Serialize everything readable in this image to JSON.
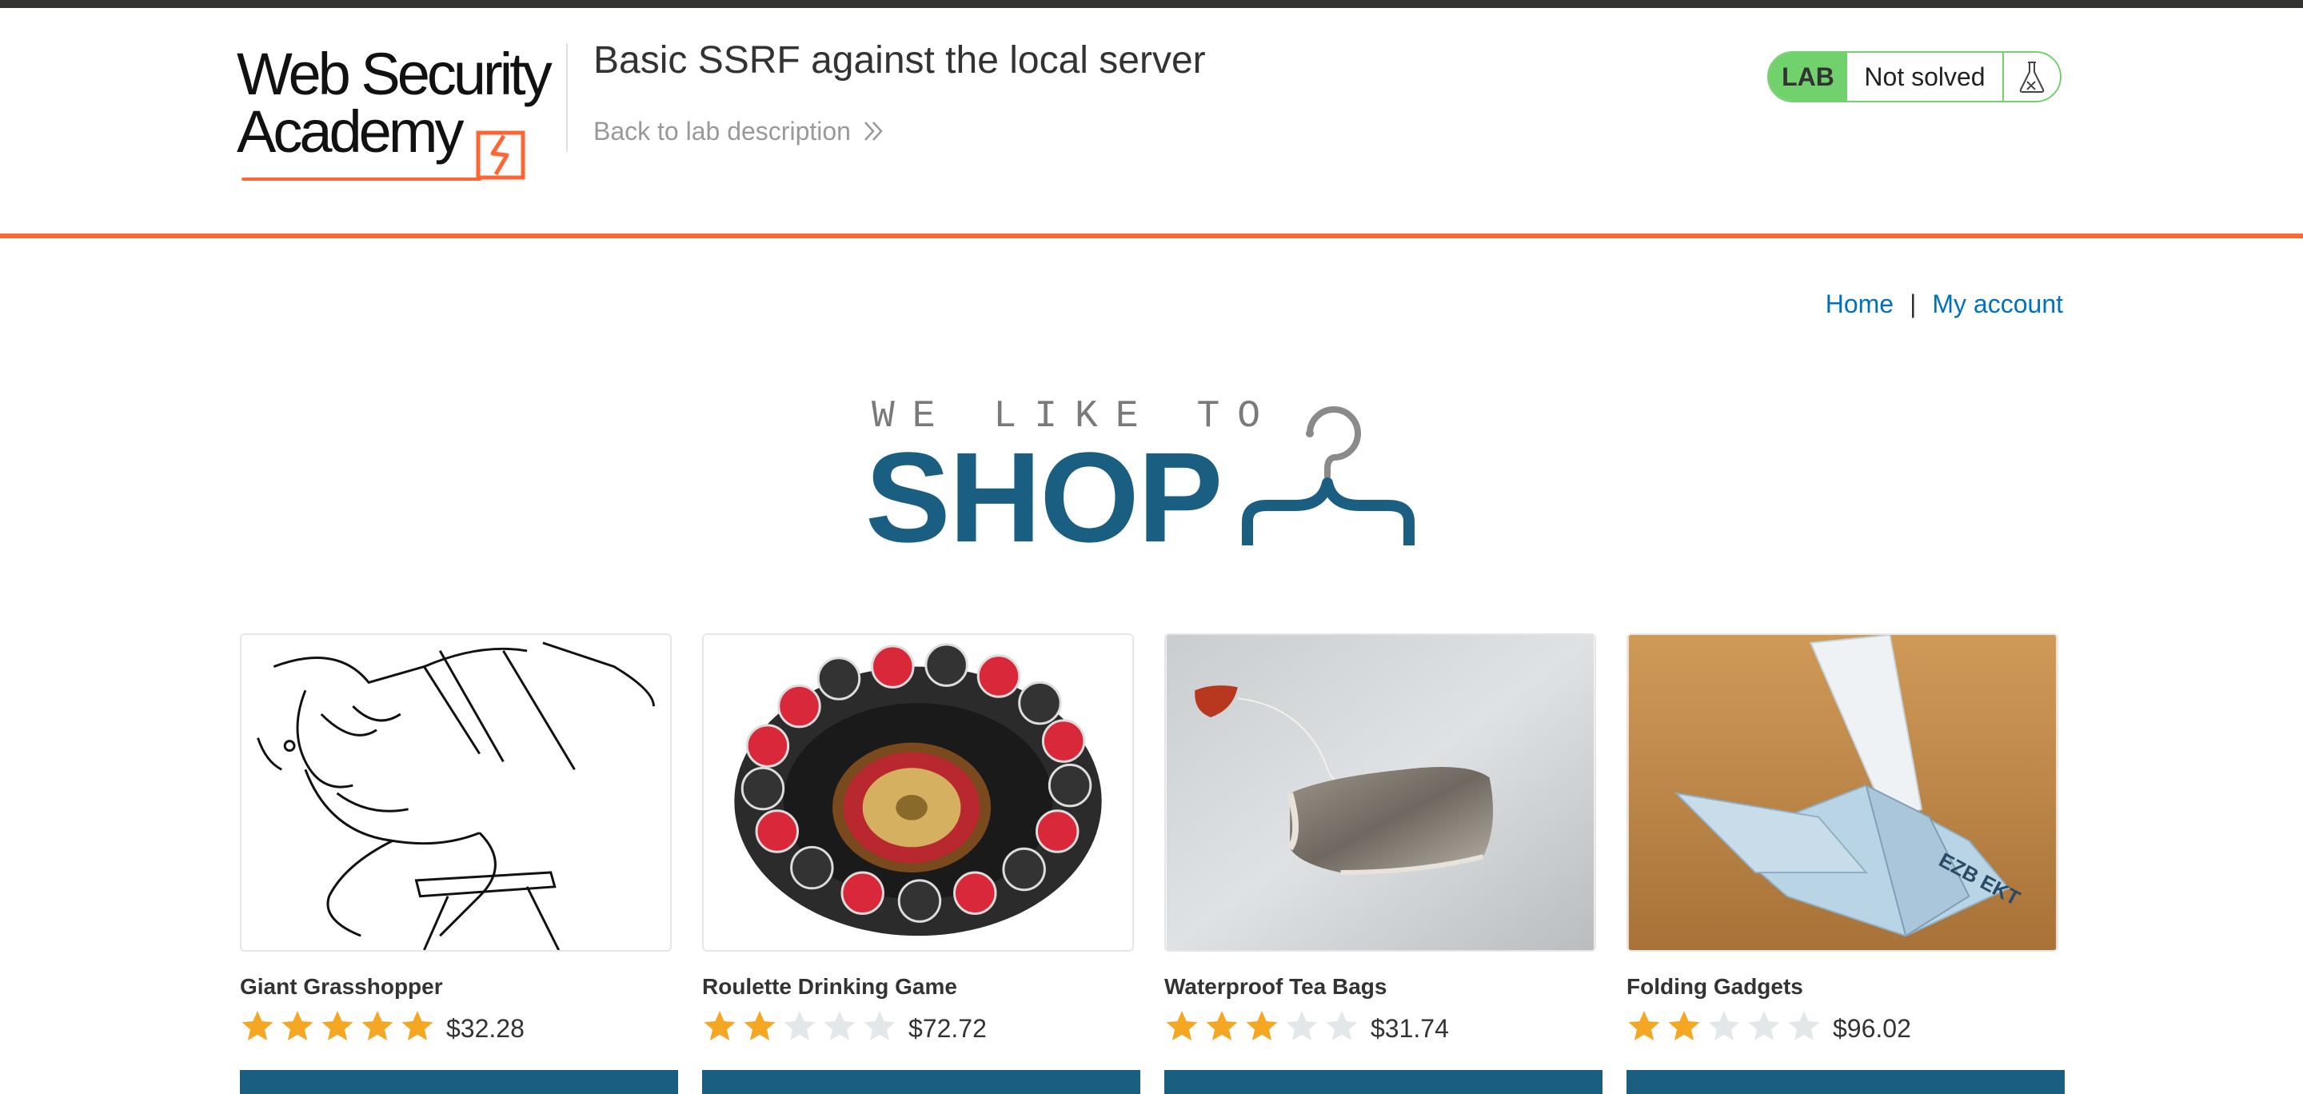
{
  "header": {
    "logo_line1": "Web Security",
    "logo_line2": "Academy",
    "lab_title": "Basic SSRF against the local server",
    "back_link": "Back to lab description",
    "lab_badge": "LAB",
    "lab_status": "Not solved",
    "lab_icon": "flask-icon"
  },
  "colors": {
    "accent": "#ff6633",
    "brand": "#1a5f82",
    "lab_green": "#70d16d",
    "link": "#0071bc",
    "star_on": "#f5a623",
    "star_off": "#e2e8ea"
  },
  "nav": {
    "home": "Home",
    "separator": "|",
    "account": "My account"
  },
  "hero": {
    "line1": "WE LIKE TO",
    "line2": "SHOP",
    "icon": "hanger-icon"
  },
  "products": [
    {
      "name": "Giant Grasshopper",
      "rating": 5,
      "price": "$32.28"
    },
    {
      "name": "Roulette Drinking Game",
      "rating": 2,
      "price": "$72.72"
    },
    {
      "name": "Waterproof Tea Bags",
      "rating": 3,
      "price": "$31.74"
    },
    {
      "name": "Folding Gadgets",
      "rating": 2,
      "price": "$96.02"
    }
  ]
}
